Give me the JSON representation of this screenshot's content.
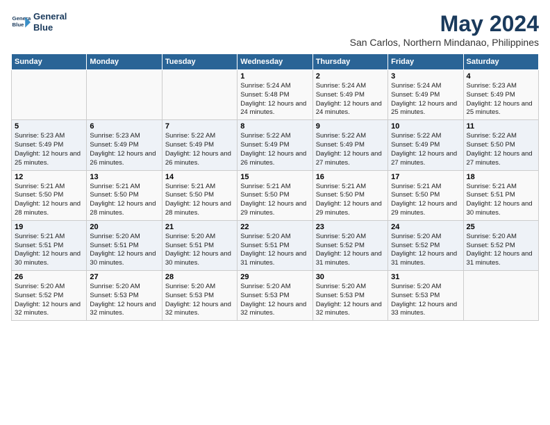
{
  "header": {
    "logo_line1": "General",
    "logo_line2": "Blue",
    "title": "May 2024",
    "subtitle": "San Carlos, Northern Mindanao, Philippines"
  },
  "days_of_week": [
    "Sunday",
    "Monday",
    "Tuesday",
    "Wednesday",
    "Thursday",
    "Friday",
    "Saturday"
  ],
  "weeks": [
    [
      {
        "day": "",
        "info": ""
      },
      {
        "day": "",
        "info": ""
      },
      {
        "day": "",
        "info": ""
      },
      {
        "day": "1",
        "info": "Sunrise: 5:24 AM\nSunset: 5:48 PM\nDaylight: 12 hours\nand 24 minutes."
      },
      {
        "day": "2",
        "info": "Sunrise: 5:24 AM\nSunset: 5:49 PM\nDaylight: 12 hours\nand 24 minutes."
      },
      {
        "day": "3",
        "info": "Sunrise: 5:24 AM\nSunset: 5:49 PM\nDaylight: 12 hours\nand 25 minutes."
      },
      {
        "day": "4",
        "info": "Sunrise: 5:23 AM\nSunset: 5:49 PM\nDaylight: 12 hours\nand 25 minutes."
      }
    ],
    [
      {
        "day": "5",
        "info": "Sunrise: 5:23 AM\nSunset: 5:49 PM\nDaylight: 12 hours\nand 25 minutes."
      },
      {
        "day": "6",
        "info": "Sunrise: 5:23 AM\nSunset: 5:49 PM\nDaylight: 12 hours\nand 26 minutes."
      },
      {
        "day": "7",
        "info": "Sunrise: 5:22 AM\nSunset: 5:49 PM\nDaylight: 12 hours\nand 26 minutes."
      },
      {
        "day": "8",
        "info": "Sunrise: 5:22 AM\nSunset: 5:49 PM\nDaylight: 12 hours\nand 26 minutes."
      },
      {
        "day": "9",
        "info": "Sunrise: 5:22 AM\nSunset: 5:49 PM\nDaylight: 12 hours\nand 27 minutes."
      },
      {
        "day": "10",
        "info": "Sunrise: 5:22 AM\nSunset: 5:49 PM\nDaylight: 12 hours\nand 27 minutes."
      },
      {
        "day": "11",
        "info": "Sunrise: 5:22 AM\nSunset: 5:50 PM\nDaylight: 12 hours\nand 27 minutes."
      }
    ],
    [
      {
        "day": "12",
        "info": "Sunrise: 5:21 AM\nSunset: 5:50 PM\nDaylight: 12 hours\nand 28 minutes."
      },
      {
        "day": "13",
        "info": "Sunrise: 5:21 AM\nSunset: 5:50 PM\nDaylight: 12 hours\nand 28 minutes."
      },
      {
        "day": "14",
        "info": "Sunrise: 5:21 AM\nSunset: 5:50 PM\nDaylight: 12 hours\nand 28 minutes."
      },
      {
        "day": "15",
        "info": "Sunrise: 5:21 AM\nSunset: 5:50 PM\nDaylight: 12 hours\nand 29 minutes."
      },
      {
        "day": "16",
        "info": "Sunrise: 5:21 AM\nSunset: 5:50 PM\nDaylight: 12 hours\nand 29 minutes."
      },
      {
        "day": "17",
        "info": "Sunrise: 5:21 AM\nSunset: 5:50 PM\nDaylight: 12 hours\nand 29 minutes."
      },
      {
        "day": "18",
        "info": "Sunrise: 5:21 AM\nSunset: 5:51 PM\nDaylight: 12 hours\nand 30 minutes."
      }
    ],
    [
      {
        "day": "19",
        "info": "Sunrise: 5:21 AM\nSunset: 5:51 PM\nDaylight: 12 hours\nand 30 minutes."
      },
      {
        "day": "20",
        "info": "Sunrise: 5:20 AM\nSunset: 5:51 PM\nDaylight: 12 hours\nand 30 minutes."
      },
      {
        "day": "21",
        "info": "Sunrise: 5:20 AM\nSunset: 5:51 PM\nDaylight: 12 hours\nand 30 minutes."
      },
      {
        "day": "22",
        "info": "Sunrise: 5:20 AM\nSunset: 5:51 PM\nDaylight: 12 hours\nand 31 minutes."
      },
      {
        "day": "23",
        "info": "Sunrise: 5:20 AM\nSunset: 5:52 PM\nDaylight: 12 hours\nand 31 minutes."
      },
      {
        "day": "24",
        "info": "Sunrise: 5:20 AM\nSunset: 5:52 PM\nDaylight: 12 hours\nand 31 minutes."
      },
      {
        "day": "25",
        "info": "Sunrise: 5:20 AM\nSunset: 5:52 PM\nDaylight: 12 hours\nand 31 minutes."
      }
    ],
    [
      {
        "day": "26",
        "info": "Sunrise: 5:20 AM\nSunset: 5:52 PM\nDaylight: 12 hours\nand 32 minutes."
      },
      {
        "day": "27",
        "info": "Sunrise: 5:20 AM\nSunset: 5:53 PM\nDaylight: 12 hours\nand 32 minutes."
      },
      {
        "day": "28",
        "info": "Sunrise: 5:20 AM\nSunset: 5:53 PM\nDaylight: 12 hours\nand 32 minutes."
      },
      {
        "day": "29",
        "info": "Sunrise: 5:20 AM\nSunset: 5:53 PM\nDaylight: 12 hours\nand 32 minutes."
      },
      {
        "day": "30",
        "info": "Sunrise: 5:20 AM\nSunset: 5:53 PM\nDaylight: 12 hours\nand 32 minutes."
      },
      {
        "day": "31",
        "info": "Sunrise: 5:20 AM\nSunset: 5:53 PM\nDaylight: 12 hours\nand 33 minutes."
      },
      {
        "day": "",
        "info": ""
      }
    ]
  ]
}
